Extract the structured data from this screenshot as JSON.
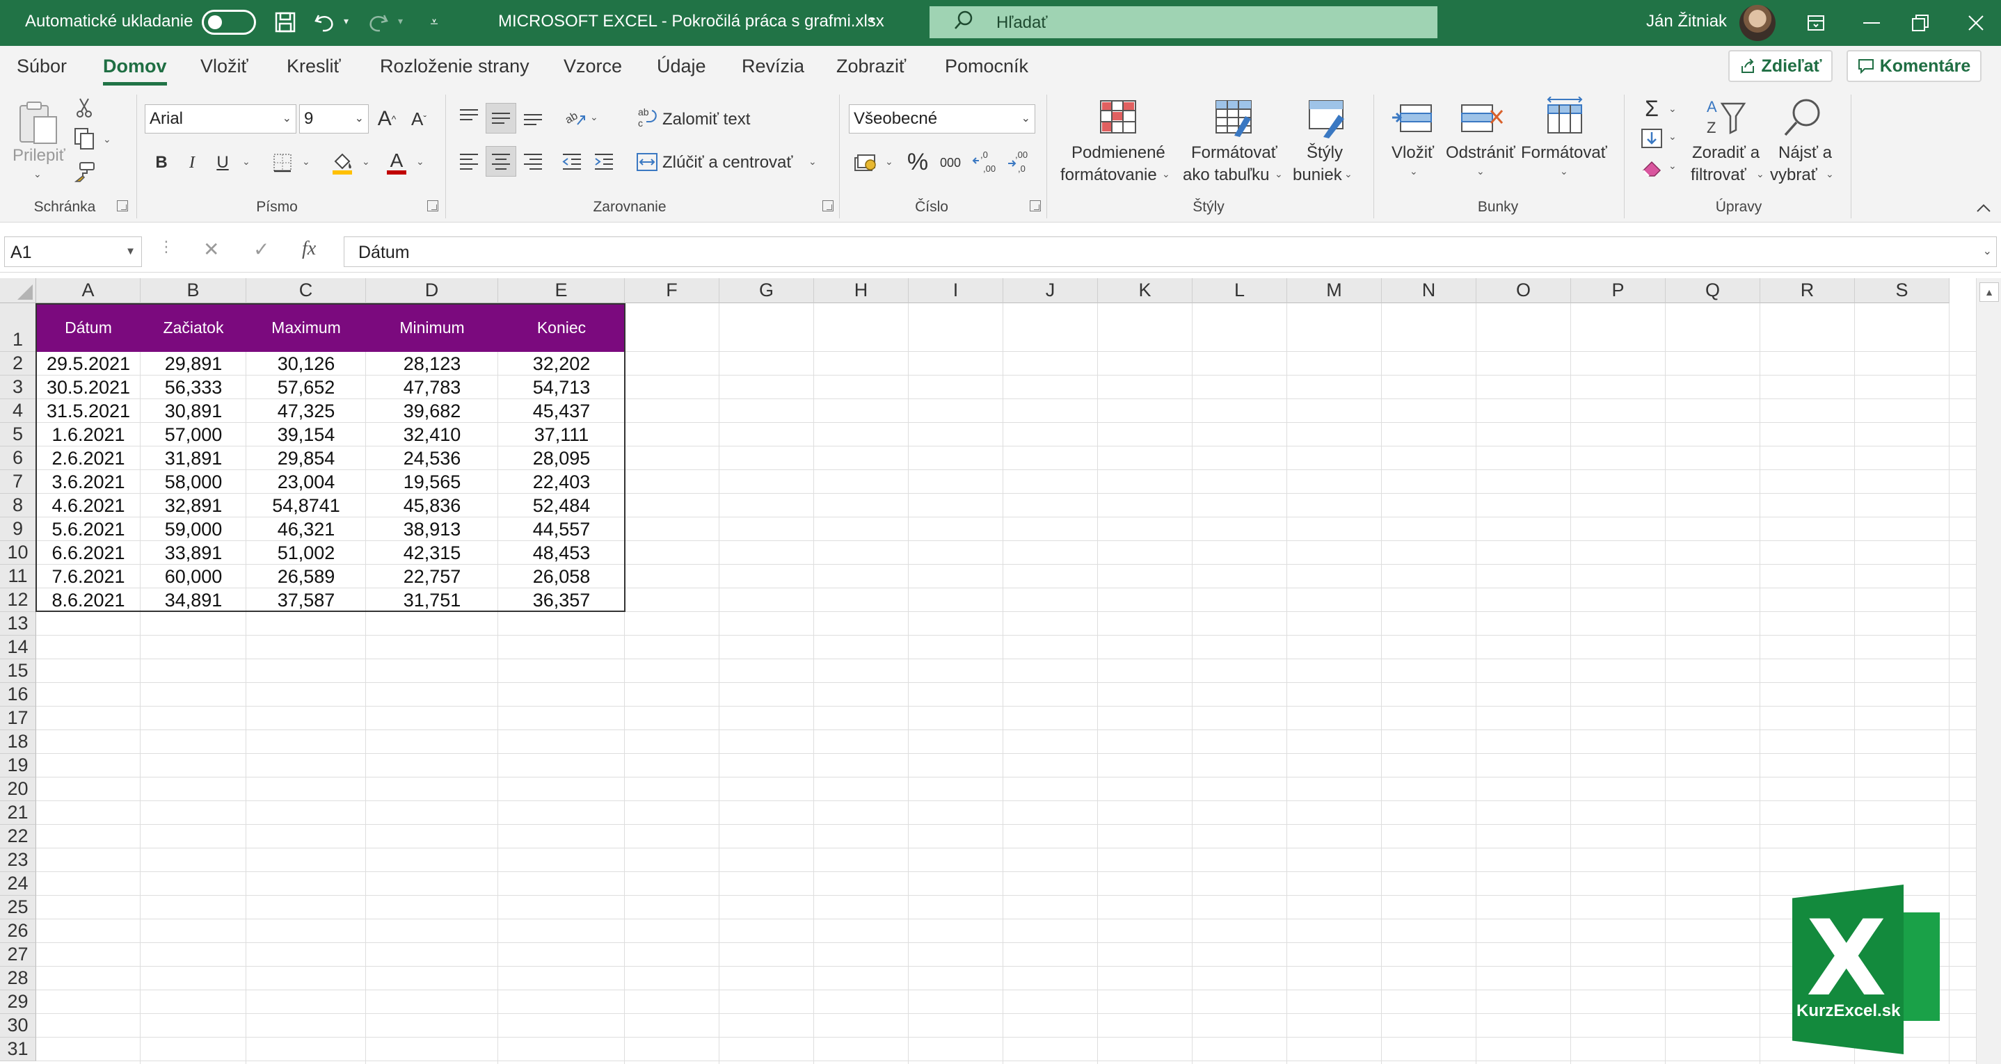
{
  "window": {
    "autosave_label": "Automatické ukladanie",
    "title": "MICROSOFT EXCEL - Pokročilá práca s grafmi.xlsx",
    "title_caret": "▾",
    "search_placeholder": "Hľadať",
    "user_name": "Ján Žitniak",
    "icons": [
      "save-icon",
      "undo-icon",
      "redo-icon",
      "customize-icon",
      "search-icon",
      "ribbon-display-icon",
      "restore-icon",
      "close-icon"
    ]
  },
  "menu": {
    "tabs": [
      "Súbor",
      "Domov",
      "Vložiť",
      "Kresliť",
      "Rozloženie strany",
      "Vzorce",
      "Údaje",
      "Revízia",
      "Zobraziť",
      "Pomocník"
    ],
    "active_tab": "Domov",
    "share_label": "Zdieľať",
    "comments_label": "Komentáre"
  },
  "ribbon": {
    "groups": {
      "clipboard": "Schránka",
      "font": "Písmo",
      "alignment": "Zarovnanie",
      "number": "Číslo",
      "styles": "Štýly",
      "cells": "Bunky",
      "editing": "Úpravy"
    },
    "paste_label": "Prilepiť",
    "font_name": "Arial",
    "font_size": "9",
    "bold": "B",
    "italic": "I",
    "underline": "U",
    "wrap_text": "Zalomiť text",
    "merge_center": "Zlúčiť a centrovať",
    "number_format": "Všeobecné",
    "percent": "%",
    "thousands": "000",
    "dec_increase": ",0 ,00",
    "dec_decrease": ",00 ,0",
    "conditional_formatting": [
      "Podmienené",
      "formátovanie"
    ],
    "format_as_table": [
      "Formátovať",
      "ako tabuľku"
    ],
    "cell_styles": [
      "Štýly",
      "buniek"
    ],
    "insert": "Vložiť",
    "delete": "Odstrániť",
    "format": "Formátovať",
    "sort_filter": [
      "Zoradiť a",
      "filtrovať"
    ],
    "find_select": [
      "Nájsť a",
      "vybrať"
    ],
    "accent_red": "#c00000",
    "accent_yellow": "#ffc000"
  },
  "formula_bar": {
    "name_box": "A1",
    "fx": "fx",
    "content": "Dátum"
  },
  "sheet": {
    "columns": [
      "A",
      "B",
      "C",
      "D",
      "E",
      "F",
      "G",
      "H",
      "I",
      "J",
      "K",
      "L",
      "M",
      "N",
      "O",
      "P",
      "Q",
      "R",
      "S"
    ],
    "rows": [
      "1",
      "2",
      "3",
      "4",
      "5",
      "6",
      "7",
      "8",
      "9",
      "10",
      "11",
      "12",
      "13",
      "14",
      "15",
      "16",
      "17",
      "18",
      "19",
      "20",
      "21",
      "22",
      "23",
      "24",
      "25",
      "26",
      "27",
      "28",
      "29",
      "30",
      "31"
    ],
    "header_fill": "#7b0a7e",
    "table": {
      "headers": [
        "Dátum",
        "Začiatok",
        "Maximum",
        "Minimum",
        "Koniec"
      ],
      "rows": [
        [
          "29.5.2021",
          "29,891",
          "30,126",
          "28,123",
          "32,202"
        ],
        [
          "30.5.2021",
          "56,333",
          "57,652",
          "47,783",
          "54,713"
        ],
        [
          "31.5.2021",
          "30,891",
          "47,325",
          "39,682",
          "45,437"
        ],
        [
          "1.6.2021",
          "57,000",
          "39,154",
          "32,410",
          "37,111"
        ],
        [
          "2.6.2021",
          "31,891",
          "29,854",
          "24,536",
          "28,095"
        ],
        [
          "3.6.2021",
          "58,000",
          "23,004",
          "19,565",
          "22,403"
        ],
        [
          "4.6.2021",
          "32,891",
          "54,8741",
          "45,836",
          "52,484"
        ],
        [
          "5.6.2021",
          "59,000",
          "46,321",
          "38,913",
          "44,557"
        ],
        [
          "6.6.2021",
          "33,891",
          "51,002",
          "42,315",
          "48,453"
        ],
        [
          "7.6.2021",
          "60,000",
          "26,589",
          "22,757",
          "26,058"
        ],
        [
          "8.6.2021",
          "34,891",
          "37,587",
          "31,751",
          "36,357"
        ]
      ]
    }
  },
  "logo": {
    "letter": "X",
    "brand": "KurzExcel.sk"
  }
}
